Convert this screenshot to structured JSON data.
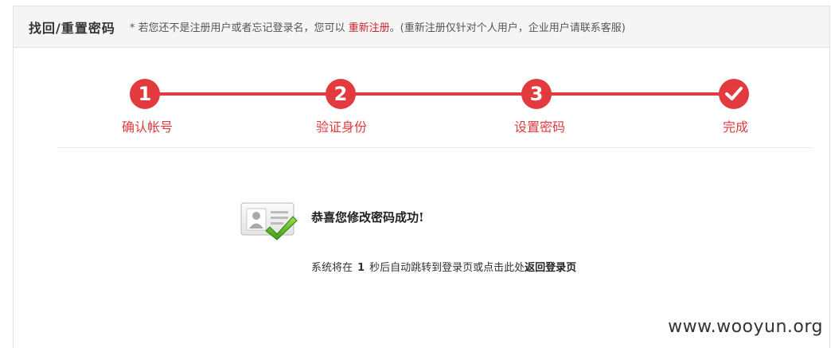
{
  "header": {
    "title": "找回/重置密码",
    "note_prefix": "* 若您还不是注册用户或者忘记登录名，您可以",
    "note_link": "重新注册",
    "note_suffix": "。(重新注册仅针对个人用户，企业用户请联系客服)"
  },
  "steps": [
    {
      "number": "1",
      "label": "确认帐号"
    },
    {
      "number": "2",
      "label": "验证身份"
    },
    {
      "number": "3",
      "label": "设置密码"
    },
    {
      "number": "",
      "label": "完成",
      "icon": "checkmark-icon"
    }
  ],
  "colors": {
    "accent": "#e23a3f",
    "link": "#c8202c"
  },
  "success": {
    "title": "恭喜您修改密码成功!",
    "desc_prefix": "系统将在",
    "countdown": "1",
    "desc_middle": "秒后自动跳转到登录页或点击此处",
    "return_link": "返回登录页"
  },
  "watermark": "www.wooyun.org"
}
